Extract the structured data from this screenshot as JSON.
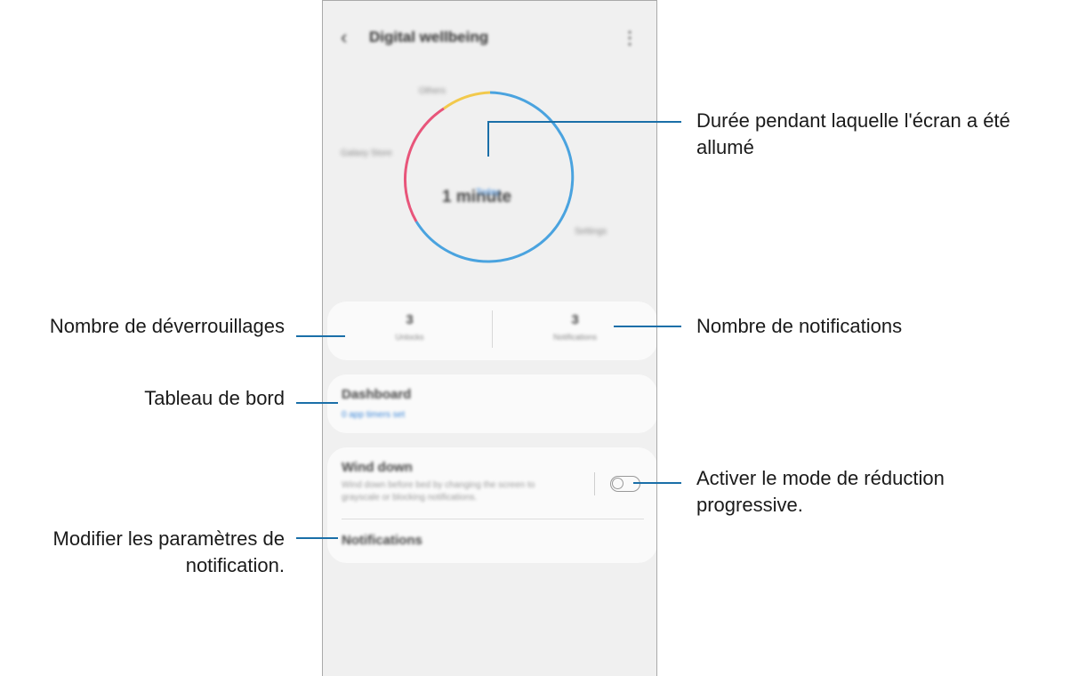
{
  "app": {
    "title": "Digital wellbeing",
    "back_icon": "chevron-left-icon",
    "more_icon": "more-vert-icon"
  },
  "chart": {
    "center_value": "1 minute",
    "center_sub": "Today",
    "legend": [
      "Others",
      "Galaxy Store",
      "Settings"
    ],
    "colors": {
      "settings": "#4aa3df",
      "galaxy_store": "#e8557a",
      "others": "#f2c94c"
    }
  },
  "stats": {
    "unlocks": {
      "value": "3",
      "label": "Unlocks"
    },
    "notifications": {
      "value": "3",
      "label": "Notifications"
    }
  },
  "dashboard": {
    "title": "Dashboard",
    "sub": "0 app timers set"
  },
  "wind_down": {
    "title": "Wind down",
    "desc": "Wind down before bed by changing the screen to grayscale or blocking notifications.",
    "notifications_label": "Notifications"
  },
  "callouts": {
    "screen_time": "Durée pendant laquelle l'écran a été allumé",
    "unlocks": "Nombre de déverrouillages",
    "notifications": "Nombre de notifications",
    "dashboard": "Tableau de bord",
    "wind_down": "Activer le mode de réduction progressive.",
    "notif_settings": "Modifier les paramètres de notification."
  }
}
